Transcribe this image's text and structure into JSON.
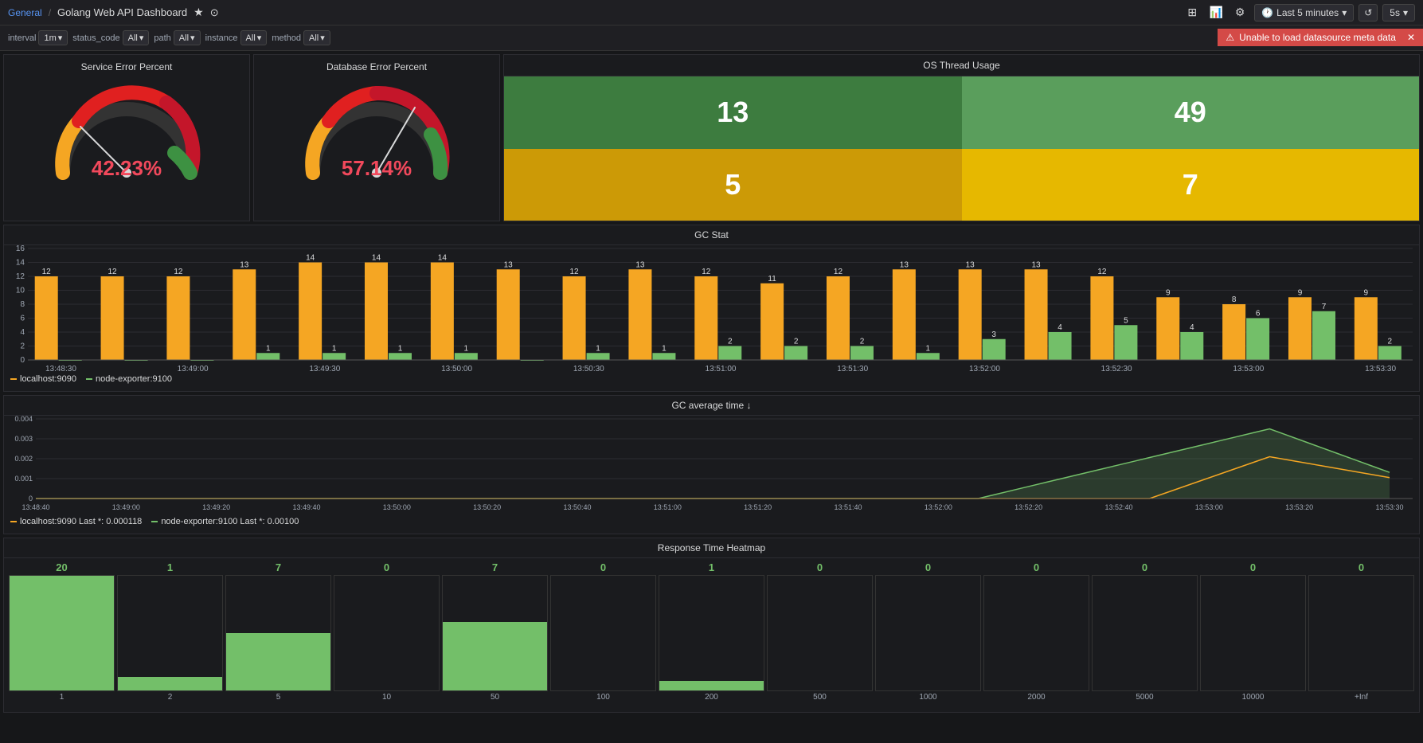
{
  "header": {
    "breadcrumb_general": "General",
    "breadcrumb_sep": "/",
    "breadcrumb_dashboard": "Golang Web API Dashboard",
    "star_icon": "★",
    "share_icon": "⊙",
    "time_range": "Last 5 minutes",
    "refresh_icon": "↺",
    "refresh_interval": "5s"
  },
  "filters": [
    {
      "label": "interval",
      "value": "1m"
    },
    {
      "label": "status_code",
      "value": "All"
    },
    {
      "label": "path",
      "value": "All"
    },
    {
      "label": "instance",
      "value": "All"
    },
    {
      "label": "method",
      "value": "All"
    }
  ],
  "alert": {
    "icon": "⚠",
    "message": "Unable to load datasource meta data",
    "close": "✕"
  },
  "service_error": {
    "title": "Service Error Percent",
    "value": "42.23%",
    "color": "#f2495c"
  },
  "database_error": {
    "title": "Database Error Percent",
    "value": "57.14%",
    "color": "#f2495c"
  },
  "os_thread": {
    "title": "OS Thread Usage",
    "cells": [
      {
        "value": "13",
        "type": "green"
      },
      {
        "value": "49",
        "type": "green-light"
      },
      {
        "value": "5",
        "type": "yellow"
      },
      {
        "value": "7",
        "type": "yellow-light"
      }
    ]
  },
  "gc_stat": {
    "title": "GC Stat",
    "legend": [
      {
        "label": "localhost:9090",
        "color": "#f5a623"
      },
      {
        "label": "node-exporter:9100",
        "color": "#73bf69"
      }
    ],
    "x_ticks": [
      "13:48:30",
      "13:49:00",
      "13:49:30",
      "13:50:00",
      "13:50:30",
      "13:51:00",
      "13:51:30",
      "13:52:00",
      "13:52:30",
      "13:53:00",
      "13:53:30"
    ],
    "y_labels": [
      "0",
      "2",
      "4",
      "6",
      "8",
      "10",
      "12",
      "14",
      "16"
    ],
    "bar_groups": [
      {
        "main": 12,
        "secondary": 0,
        "x_label": "13:48:30"
      },
      {
        "main": 12,
        "secondary": 0,
        "x_label": ""
      },
      {
        "main": 12,
        "secondary": 0,
        "x_label": "13:49:00"
      },
      {
        "main": 13,
        "secondary": 1,
        "x_label": ""
      },
      {
        "main": 14,
        "secondary": 1,
        "x_label": "13:49:30"
      },
      {
        "main": 14,
        "secondary": 1,
        "x_label": ""
      },
      {
        "main": 14,
        "secondary": 1,
        "x_label": "13:50:00"
      },
      {
        "main": 13,
        "secondary": 0,
        "x_label": ""
      },
      {
        "main": 12,
        "secondary": 1,
        "x_label": "13:50:30"
      },
      {
        "main": 13,
        "secondary": 1,
        "x_label": ""
      },
      {
        "main": 12,
        "secondary": 2,
        "x_label": "13:51:00"
      },
      {
        "main": 11,
        "secondary": 2,
        "x_label": ""
      },
      {
        "main": 12,
        "secondary": 2,
        "x_label": "13:51:30"
      },
      {
        "main": 13,
        "secondary": 1,
        "x_label": ""
      },
      {
        "main": 13,
        "secondary": 3,
        "x_label": "13:52:00"
      },
      {
        "main": 13,
        "secondary": 4,
        "x_label": ""
      },
      {
        "main": 12,
        "secondary": 5,
        "x_label": "13:52:30"
      },
      {
        "main": 9,
        "secondary": 4,
        "x_label": ""
      },
      {
        "main": 8,
        "secondary": 6,
        "x_label": "13:53:00"
      },
      {
        "main": 9,
        "secondary": 7,
        "x_label": ""
      },
      {
        "main": 9,
        "secondary": 2,
        "x_label": "13:53:30"
      }
    ]
  },
  "gc_avg_time": {
    "title": "GC average time ↓",
    "legend": [
      {
        "label": "localhost:9090  Last *: 0.000118",
        "color": "#f5a623"
      },
      {
        "label": "node-exporter:9100  Last *: 0.00100",
        "color": "#73bf69"
      }
    ],
    "y_labels": [
      "0",
      "0.001",
      "0.002",
      "0.003",
      "0.004"
    ],
    "x_ticks": [
      "13:48:40",
      "13:49:00",
      "13:49:20",
      "13:49:40",
      "13:50:00",
      "13:50:20",
      "13:50:40",
      "13:51:00",
      "13:51:20",
      "13:51:40",
      "13:52:00",
      "13:52:20",
      "13:52:40",
      "13:53:00",
      "13:53:20",
      "13:53:30"
    ]
  },
  "heatmap": {
    "title": "Response Time Heatmap",
    "columns": [
      {
        "value": "20",
        "height_pct": 100,
        "x_label": "1"
      },
      {
        "value": "1",
        "height_pct": 12,
        "x_label": "2"
      },
      {
        "value": "7",
        "height_pct": 50,
        "x_label": "5"
      },
      {
        "value": "0",
        "height_pct": 0,
        "x_label": "10"
      },
      {
        "value": "7",
        "height_pct": 60,
        "x_label": "50"
      },
      {
        "value": "0",
        "height_pct": 0,
        "x_label": "100"
      },
      {
        "value": "1",
        "height_pct": 8,
        "x_label": "200"
      },
      {
        "value": "0",
        "height_pct": 0,
        "x_label": "500"
      },
      {
        "value": "0",
        "height_pct": 0,
        "x_label": "1000"
      },
      {
        "value": "0",
        "height_pct": 0,
        "x_label": "2000"
      },
      {
        "value": "0",
        "height_pct": 0,
        "x_label": "5000"
      },
      {
        "value": "0",
        "height_pct": 0,
        "x_label": "10000"
      },
      {
        "value": "0",
        "height_pct": 0,
        "x_label": "+Inf"
      }
    ]
  }
}
